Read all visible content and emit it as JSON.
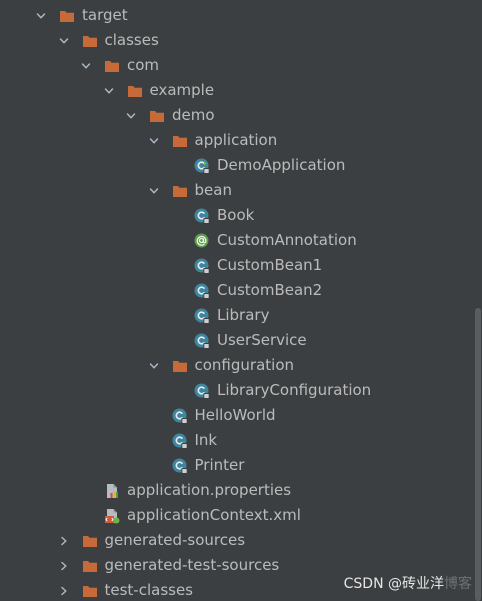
{
  "tree": {
    "rows": [
      {
        "label": "target",
        "icon": "folder-icon",
        "expand": "expanded",
        "depth": 0
      },
      {
        "label": "classes",
        "icon": "folder-icon",
        "expand": "expanded",
        "depth": 1
      },
      {
        "label": "com",
        "icon": "folder-icon",
        "expand": "expanded",
        "depth": 2
      },
      {
        "label": "example",
        "icon": "folder-icon",
        "expand": "expanded",
        "depth": 3
      },
      {
        "label": "demo",
        "icon": "folder-icon",
        "expand": "expanded",
        "depth": 4
      },
      {
        "label": "application",
        "icon": "folder-icon",
        "expand": "expanded",
        "depth": 5
      },
      {
        "label": "DemoApplication",
        "icon": "spring-boot-class-icon",
        "expand": "none",
        "depth": 6
      },
      {
        "label": "bean",
        "icon": "folder-icon",
        "expand": "expanded",
        "depth": 5
      },
      {
        "label": "Book",
        "icon": "class-icon",
        "expand": "none",
        "depth": 6
      },
      {
        "label": "CustomAnnotation",
        "icon": "annotation-icon",
        "expand": "none",
        "depth": 6
      },
      {
        "label": "CustomBean1",
        "icon": "class-icon",
        "expand": "none",
        "depth": 6
      },
      {
        "label": "CustomBean2",
        "icon": "class-icon",
        "expand": "none",
        "depth": 6
      },
      {
        "label": "Library",
        "icon": "class-icon",
        "expand": "none",
        "depth": 6
      },
      {
        "label": "UserService",
        "icon": "class-icon",
        "expand": "none",
        "depth": 6
      },
      {
        "label": "configuration",
        "icon": "folder-icon",
        "expand": "expanded",
        "depth": 5
      },
      {
        "label": "LibraryConfiguration",
        "icon": "class-icon",
        "expand": "none",
        "depth": 6
      },
      {
        "label": "HelloWorld",
        "icon": "class-icon",
        "expand": "none",
        "depth": 5
      },
      {
        "label": "Ink",
        "icon": "class-icon",
        "expand": "none",
        "depth": 5
      },
      {
        "label": "Printer",
        "icon": "class-icon",
        "expand": "none",
        "depth": 5
      },
      {
        "label": "application.properties",
        "icon": "properties-file-icon",
        "expand": "none",
        "depth": 2
      },
      {
        "label": "applicationContext.xml",
        "icon": "spring-xml-file-icon",
        "expand": "none",
        "depth": 2
      },
      {
        "label": "generated-sources",
        "icon": "folder-icon",
        "expand": "collapsed",
        "depth": 1
      },
      {
        "label": "generated-test-sources",
        "icon": "folder-icon",
        "expand": "collapsed",
        "depth": 1
      },
      {
        "label": "test-classes",
        "icon": "folder-icon",
        "expand": "collapsed",
        "depth": 1
      }
    ]
  },
  "watermark": {
    "text": "CSDN @砖业洋",
    "faint_text": "博客"
  },
  "colors": {
    "background": "#3c3f41",
    "text": "#bbbbbb",
    "folder": "#c76a3a",
    "class_circle": "#3e86a0",
    "annotation_circle": "#5a9e4a",
    "arrow": "#a9b7c6"
  }
}
